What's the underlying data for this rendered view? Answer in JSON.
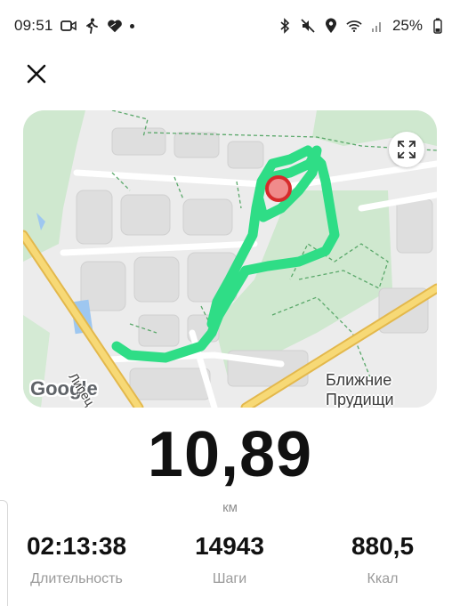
{
  "status_bar": {
    "time": "09:51",
    "battery": "25%",
    "left_icons": [
      "video-camera-icon",
      "walking-icon",
      "heart-icon",
      "dot-icon"
    ],
    "right_icons": [
      "bluetooth-icon",
      "mute-icon",
      "location-icon",
      "wifi-icon",
      "signal-icon",
      "battery-icon"
    ]
  },
  "header": {
    "close_icon": "close-icon"
  },
  "map": {
    "attribution": "Google",
    "place_label_line1": "Ближние",
    "place_label_line2": "Прудищи",
    "street_label": "Липец",
    "route_color": "#2fdd86",
    "marker_color": "#e63946",
    "expand_icon": "expand-icon"
  },
  "summary": {
    "distance": "10,89",
    "distance_unit": "км"
  },
  "stats": [
    {
      "value": "02:13:38",
      "label": "Длительность"
    },
    {
      "value": "14943",
      "label": "Шаги"
    },
    {
      "value": "880,5",
      "label": "Ккал"
    }
  ]
}
